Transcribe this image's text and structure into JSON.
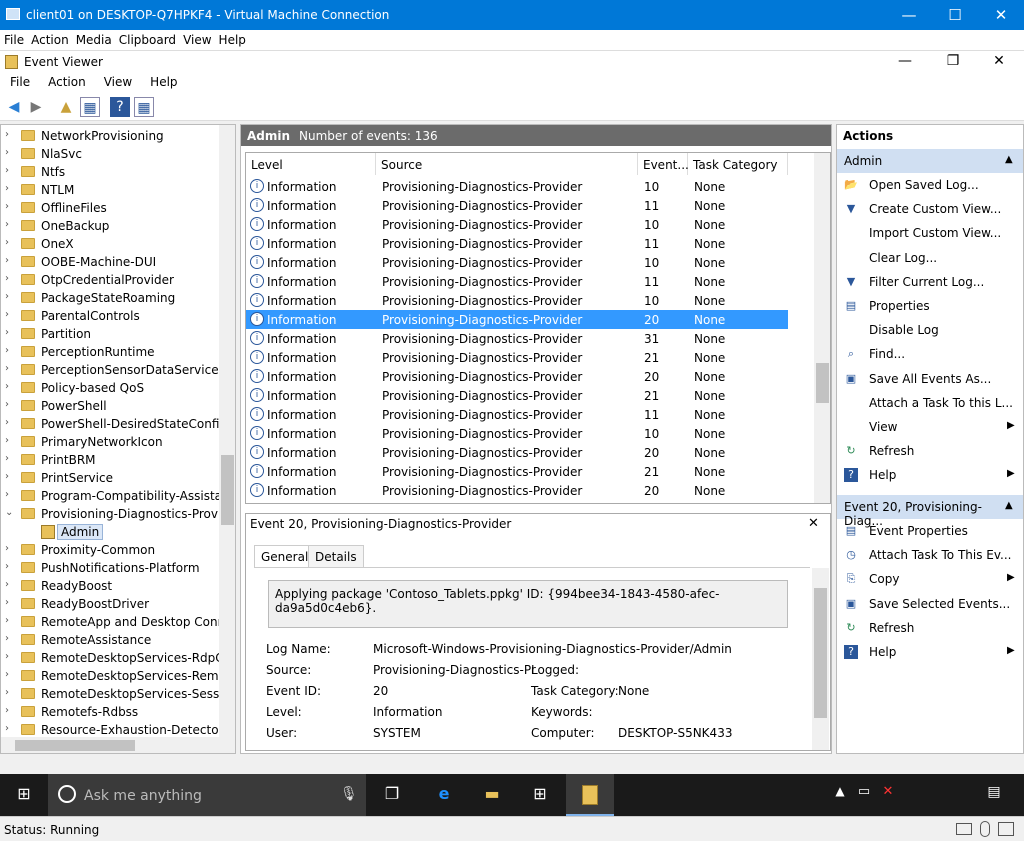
{
  "vm_window": {
    "title": "client01 on DESKTOP-Q7HPKF4 - Virtual Machine Connection",
    "minimize": "—",
    "maximize": "☐",
    "close": "✕"
  },
  "vm_menu": [
    "File",
    "Action",
    "Media",
    "Clipboard",
    "View",
    "Help"
  ],
  "ev_window": {
    "title": "Event Viewer",
    "minimize": "—",
    "restore": "❐",
    "close": "✕"
  },
  "ev_menu": [
    "File",
    "Action",
    "View",
    "Help"
  ],
  "tree": {
    "items": [
      {
        "label": "NetworkProvisioning",
        "expanded": false
      },
      {
        "label": "NlaSvc",
        "expanded": false
      },
      {
        "label": "Ntfs",
        "expanded": false
      },
      {
        "label": "NTLM",
        "expanded": false
      },
      {
        "label": "OfflineFiles",
        "expanded": false
      },
      {
        "label": "OneBackup",
        "expanded": false
      },
      {
        "label": "OneX",
        "expanded": false
      },
      {
        "label": "OOBE-Machine-DUI",
        "expanded": false
      },
      {
        "label": "OtpCredentialProvider",
        "expanded": false
      },
      {
        "label": "PackageStateRoaming",
        "expanded": false
      },
      {
        "label": "ParentalControls",
        "expanded": false
      },
      {
        "label": "Partition",
        "expanded": false
      },
      {
        "label": "PerceptionRuntime",
        "expanded": false
      },
      {
        "label": "PerceptionSensorDataService",
        "expanded": false
      },
      {
        "label": "Policy-based QoS",
        "expanded": false
      },
      {
        "label": "PowerShell",
        "expanded": false
      },
      {
        "label": "PowerShell-DesiredStateConfigura",
        "expanded": false
      },
      {
        "label": "PrimaryNetworkIcon",
        "expanded": false
      },
      {
        "label": "PrintBRM",
        "expanded": false
      },
      {
        "label": "PrintService",
        "expanded": false
      },
      {
        "label": "Program-Compatibility-Assistant",
        "expanded": false
      },
      {
        "label": "Provisioning-Diagnostics-Provide",
        "expanded": true
      },
      {
        "label": "Admin",
        "child": true
      },
      {
        "label": "Proximity-Common",
        "expanded": false
      },
      {
        "label": "PushNotifications-Platform",
        "expanded": false
      },
      {
        "label": "ReadyBoost",
        "expanded": false
      },
      {
        "label": "ReadyBoostDriver",
        "expanded": false
      },
      {
        "label": "RemoteApp and Desktop Connec",
        "expanded": false
      },
      {
        "label": "RemoteAssistance",
        "expanded": false
      },
      {
        "label": "RemoteDesktopServices-RdpCore",
        "expanded": false
      },
      {
        "label": "RemoteDesktopServices-RemoteF",
        "expanded": false
      },
      {
        "label": "RemoteDesktopServices-SessionS",
        "expanded": false
      },
      {
        "label": "Remotefs-Rdbss",
        "expanded": false
      },
      {
        "label": "Resource-Exhaustion-Detector",
        "expanded": false
      }
    ]
  },
  "center": {
    "log_name": "Admin",
    "count_text": "Number of events: 136",
    "columns": [
      "Level",
      "Source",
      "Event...",
      "Task Category"
    ],
    "rows": [
      {
        "level": "Information",
        "source": "Provisioning-Diagnostics-Provider",
        "id": "10",
        "cat": "None"
      },
      {
        "level": "Information",
        "source": "Provisioning-Diagnostics-Provider",
        "id": "11",
        "cat": "None"
      },
      {
        "level": "Information",
        "source": "Provisioning-Diagnostics-Provider",
        "id": "10",
        "cat": "None"
      },
      {
        "level": "Information",
        "source": "Provisioning-Diagnostics-Provider",
        "id": "11",
        "cat": "None"
      },
      {
        "level": "Information",
        "source": "Provisioning-Diagnostics-Provider",
        "id": "10",
        "cat": "None"
      },
      {
        "level": "Information",
        "source": "Provisioning-Diagnostics-Provider",
        "id": "11",
        "cat": "None"
      },
      {
        "level": "Information",
        "source": "Provisioning-Diagnostics-Provider",
        "id": "10",
        "cat": "None"
      },
      {
        "level": "Information",
        "source": "Provisioning-Diagnostics-Provider",
        "id": "20",
        "cat": "None",
        "selected": true
      },
      {
        "level": "Information",
        "source": "Provisioning-Diagnostics-Provider",
        "id": "31",
        "cat": "None"
      },
      {
        "level": "Information",
        "source": "Provisioning-Diagnostics-Provider",
        "id": "21",
        "cat": "None"
      },
      {
        "level": "Information",
        "source": "Provisioning-Diagnostics-Provider",
        "id": "20",
        "cat": "None"
      },
      {
        "level": "Information",
        "source": "Provisioning-Diagnostics-Provider",
        "id": "21",
        "cat": "None"
      },
      {
        "level": "Information",
        "source": "Provisioning-Diagnostics-Provider",
        "id": "11",
        "cat": "None"
      },
      {
        "level": "Information",
        "source": "Provisioning-Diagnostics-Provider",
        "id": "10",
        "cat": "None"
      },
      {
        "level": "Information",
        "source": "Provisioning-Diagnostics-Provider",
        "id": "20",
        "cat": "None"
      },
      {
        "level": "Information",
        "source": "Provisioning-Diagnostics-Provider",
        "id": "21",
        "cat": "None"
      },
      {
        "level": "Information",
        "source": "Provisioning-Diagnostics-Provider",
        "id": "20",
        "cat": "None"
      }
    ]
  },
  "detail": {
    "title": "Event 20, Provisioning-Diagnostics-Provider",
    "close": "✕",
    "tabs": [
      "General",
      "Details"
    ],
    "description": "Applying package 'Contoso_Tablets.ppkg' ID: {994bee34-1843-4580-afec-da9a5d0c4eb6}.",
    "log_name_label": "Log Name:",
    "log_name_value": "Microsoft-Windows-Provisioning-Diagnostics-Provider/Admin",
    "source_label": "Source:",
    "source_value": "Provisioning-Diagnostics-Pr",
    "logged_label": "Logged:",
    "event_id_label": "Event ID:",
    "event_id_value": "20",
    "task_cat_label": "Task Category:",
    "task_cat_value": "None",
    "level_label": "Level:",
    "level_value": "Information",
    "keywords_label": "Keywords:",
    "user_label": "User:",
    "user_value": "SYSTEM",
    "computer_label": "Computer:",
    "computer_value": "DESKTOP-S5NK433"
  },
  "actions": {
    "header": "Actions",
    "section1": "Admin",
    "items1": [
      {
        "icon": "open-folder-icon",
        "glyph": "📂",
        "label": "Open Saved Log...",
        "submenu": false
      },
      {
        "icon": "filter-icon",
        "glyph": "▼",
        "label": "Create Custom View...",
        "submenu": false
      },
      {
        "icon": "",
        "glyph": "",
        "label": "Import Custom View...",
        "submenu": false
      },
      {
        "icon": "",
        "glyph": "",
        "label": "Clear Log...",
        "submenu": false
      },
      {
        "icon": "filter-icon",
        "glyph": "▼",
        "label": "Filter Current Log...",
        "submenu": false
      },
      {
        "icon": "properties-icon",
        "glyph": "▤",
        "label": "Properties",
        "submenu": false
      },
      {
        "icon": "",
        "glyph": "",
        "label": "Disable Log",
        "submenu": false
      },
      {
        "icon": "binoculars-icon",
        "glyph": "⌕",
        "label": "Find...",
        "submenu": false
      },
      {
        "icon": "save-icon",
        "glyph": "▣",
        "label": "Save All Events As...",
        "submenu": false
      },
      {
        "icon": "",
        "glyph": "",
        "label": "Attach a Task To this L...",
        "submenu": false
      },
      {
        "icon": "",
        "glyph": "",
        "label": "View",
        "submenu": true
      },
      {
        "icon": "refresh-icon",
        "glyph": "↻",
        "label": "Refresh",
        "submenu": false
      },
      {
        "icon": "help-icon",
        "glyph": "?",
        "label": "Help",
        "submenu": true
      }
    ],
    "section2": "Event 20, Provisioning-Diag...",
    "items2": [
      {
        "icon": "event-properties-icon",
        "glyph": "▤",
        "label": "Event Properties",
        "submenu": false
      },
      {
        "icon": "task-icon",
        "glyph": "◷",
        "label": "Attach Task To This Ev...",
        "submenu": false
      },
      {
        "icon": "copy-icon",
        "glyph": "⎘",
        "label": "Copy",
        "submenu": true
      },
      {
        "icon": "save-icon",
        "glyph": "▣",
        "label": "Save Selected Events...",
        "submenu": false
      },
      {
        "icon": "refresh-icon",
        "glyph": "↻",
        "label": "Refresh",
        "submenu": false
      },
      {
        "icon": "help-icon",
        "glyph": "?",
        "label": "Help",
        "submenu": true
      }
    ]
  },
  "taskbar": {
    "search_placeholder": "Ask me anything"
  },
  "status": {
    "text": "Status: Running"
  },
  "colors": {
    "titlebar": "#0078d7",
    "selection": "#3399ff",
    "section": "#d0dff2",
    "taskbar": "#1a1a1a"
  }
}
